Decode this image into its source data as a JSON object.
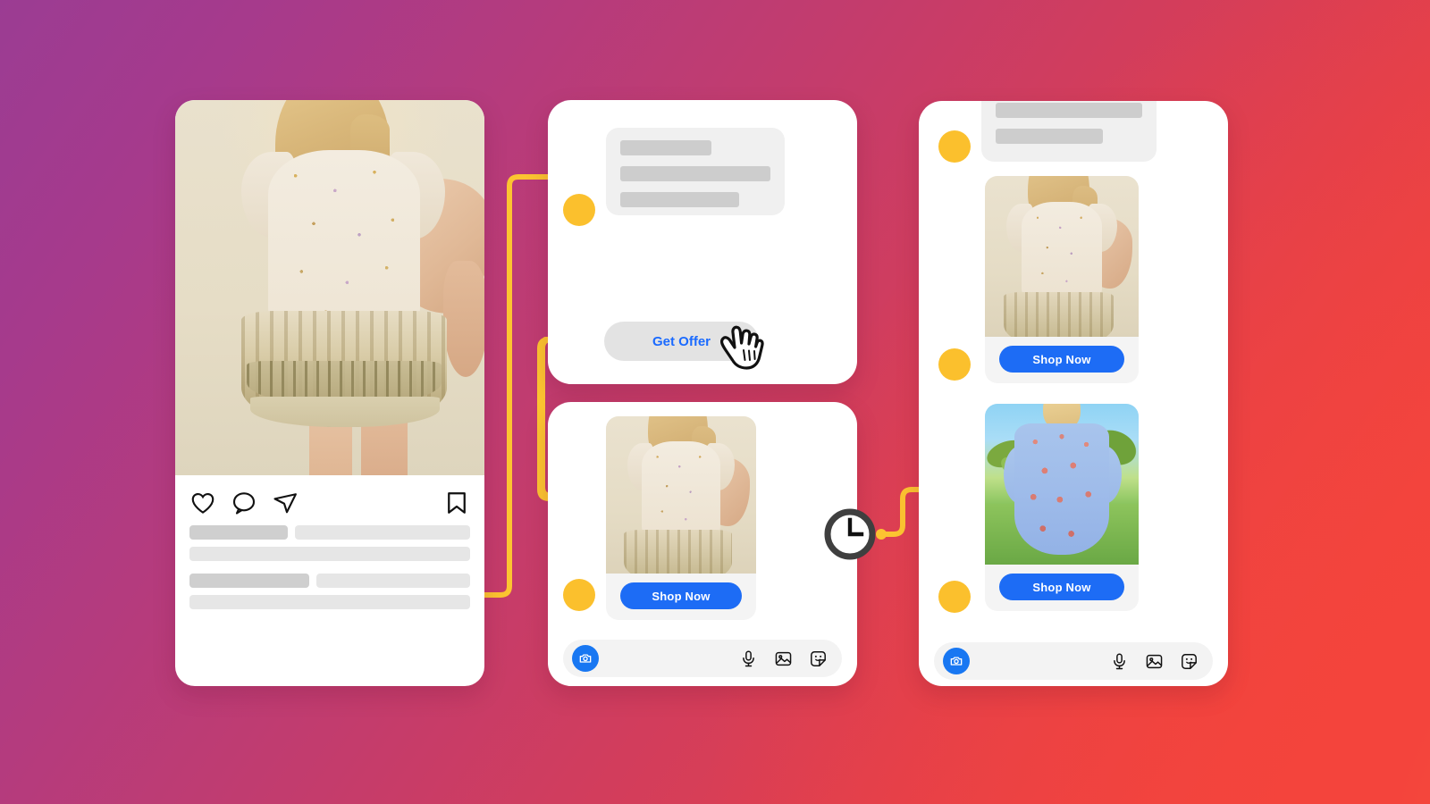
{
  "background": {
    "gradient_from": "#9b3c93",
    "gradient_mid": "#bc3f75",
    "gradient_to": "#f4443c"
  },
  "accent": {
    "yellow": "#fbc02d",
    "connector_yellow": "#fcc431",
    "blue_button": "#1d6cf5",
    "blue_link": "#1a6aff",
    "camera_blue": "#1877f2",
    "skeleton_light": "#e6e6e6",
    "skeleton_dark": "#cfcfcf",
    "bubble_gray": "#f0f0f0"
  },
  "instagram_post": {
    "name": "instagram-post-card",
    "photo_alt": "model wearing cream floral ruffle-sleeve dress",
    "actions": [
      {
        "name": "like-icon",
        "label": "Like"
      },
      {
        "name": "comment-icon",
        "label": "Comment"
      },
      {
        "name": "share-icon",
        "label": "Share"
      },
      {
        "name": "bookmark-icon",
        "label": "Save"
      }
    ],
    "caption_placeholder_rows": 2,
    "comment_placeholder_rows": 2,
    "quote_rows": 1
  },
  "chat_top": {
    "name": "chat-card-offer",
    "message_bubble": {
      "lines": 3
    },
    "get_offer_button": {
      "label": "Get Offer"
    },
    "cursor": {
      "name": "hand-cursor-icon",
      "label": "pointer"
    },
    "yellow_dot_label": "step marker"
  },
  "chat_middle": {
    "name": "chat-card-product",
    "product": {
      "image_alt": "cream floral ruffle-sleeve dress",
      "cta_label": "Shop Now"
    },
    "input_bar": {
      "camera_button": {
        "name": "camera-icon",
        "label": "Camera"
      },
      "icons": [
        {
          "name": "microphone-icon",
          "label": "Voice message"
        },
        {
          "name": "image-icon",
          "label": "Photo"
        },
        {
          "name": "sticker-icon",
          "label": "Sticker"
        }
      ]
    }
  },
  "chat_right": {
    "name": "chat-card-followup",
    "message_bubble": {
      "lines": 2
    },
    "products": [
      {
        "image_alt": "cream floral ruffle-sleeve dress",
        "cta_label": "Shop Now"
      },
      {
        "image_alt": "blue and red print tiered mini dress outdoors",
        "cta_label": "Shop Now"
      }
    ],
    "input_bar": {
      "camera_button": {
        "name": "camera-icon",
        "label": "Camera"
      },
      "icons": [
        {
          "name": "microphone-icon",
          "label": "Voice message"
        },
        {
          "name": "image-icon",
          "label": "Photo"
        },
        {
          "name": "sticker-icon",
          "label": "Sticker"
        }
      ]
    }
  },
  "flow": {
    "clock_badge": {
      "name": "clock-icon",
      "label": "delayed follow-up"
    },
    "connectors": [
      {
        "from": "instagram-post-card",
        "to": "chat-card-offer"
      },
      {
        "from": "get-offer-button",
        "to": "chat-card-product"
      },
      {
        "from": "clock-icon",
        "to": "chat-card-followup-product-2"
      }
    ]
  }
}
